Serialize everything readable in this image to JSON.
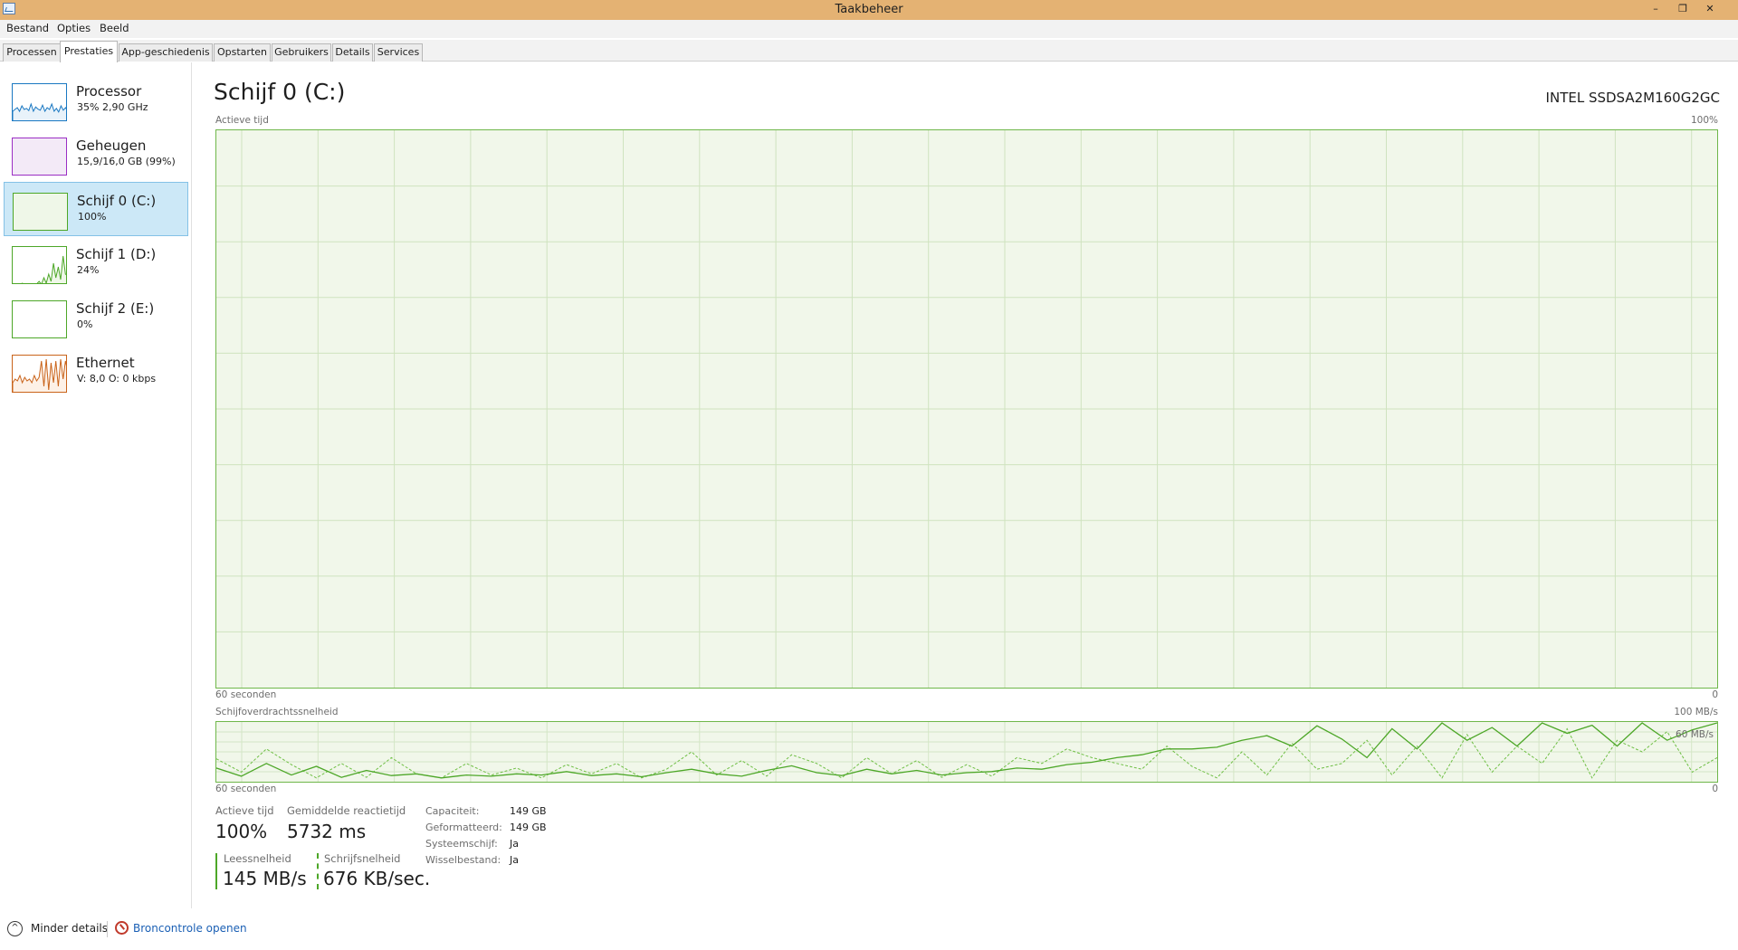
{
  "window": {
    "title": "Taakbeheer",
    "min_glyph": "–",
    "max_glyph": "❐",
    "close_glyph": "✕"
  },
  "menu": [
    "Bestand",
    "Opties",
    "Beeld"
  ],
  "tabs": [
    "Processen",
    "Prestaties",
    "App-geschiedenis",
    "Opstarten",
    "Gebruikers",
    "Details",
    "Services"
  ],
  "active_tab": "Prestaties",
  "sidebar": {
    "items": [
      {
        "title": "Processor",
        "sub": "35% 2,90 GHz",
        "color": "#1a78c2",
        "fill": "#e8f2fa",
        "level": 0.35
      },
      {
        "title": "Geheugen",
        "sub": "15,9/16,0 GB (99%)",
        "color": "#9b2ec4",
        "fill": "#f3eaf7",
        "level": 0.99
      },
      {
        "title": "Schijf 0 (C:)",
        "sub": "100%",
        "color": "#4da728",
        "fill": "#eff7e8",
        "level": 1.0,
        "selected": true
      },
      {
        "title": "Schijf 1 (D:)",
        "sub": "24%",
        "color": "#4da728",
        "fill": "#ffffff",
        "level": 0.24
      },
      {
        "title": "Schijf 2 (E:)",
        "sub": "0%",
        "color": "#4da728",
        "fill": "#ffffff",
        "level": 0.0
      },
      {
        "title": "Ethernet",
        "sub": "V: 8,0 O: 0 kbps",
        "color": "#c9631a",
        "fill": "#fdf1e7",
        "level": 0.6
      }
    ]
  },
  "disk": {
    "title": "Schijf 0 (C:)",
    "model": "INTEL SSDSA2M160G2GC",
    "active_time_graph": {
      "label": "Actieve tijd",
      "max_label": "100%",
      "left_label": "60 seconden",
      "right_label": "0",
      "value_percent": 100
    },
    "transfer_graph": {
      "label": "Schijfoverdrachtssnelheid",
      "max_label": "100 MB/s",
      "inner_max_label": "60 MB/s",
      "left_label": "60 seconden",
      "right_label": "0",
      "read_mbps": [
        22,
        8,
        30,
        10,
        25,
        6,
        18,
        9,
        12,
        5,
        10,
        8,
        12,
        10,
        16,
        9,
        12,
        7,
        14,
        20,
        12,
        8,
        18,
        26,
        14,
        9,
        20,
        12,
        18,
        10,
        14,
        16,
        22,
        20,
        28,
        32,
        40,
        45,
        55,
        55,
        58,
        70,
        78,
        60,
        95,
        72,
        40,
        90,
        55,
        100,
        70,
        92,
        60,
        100,
        82,
        96,
        60,
        100,
        70,
        88,
        100
      ],
      "write_mbps": [
        38,
        15,
        55,
        28,
        5,
        30,
        6,
        40,
        12,
        5,
        30,
        10,
        22,
        5,
        28,
        12,
        30,
        5,
        20,
        50,
        10,
        35,
        8,
        45,
        30,
        5,
        40,
        12,
        35,
        6,
        28,
        8,
        40,
        30,
        55,
        40,
        30,
        20,
        60,
        25,
        5,
        50,
        10,
        65,
        20,
        30,
        70,
        10,
        60,
        5,
        80,
        15,
        60,
        30,
        90,
        5,
        70,
        50,
        85,
        15,
        40
      ]
    },
    "stats": {
      "active_time_label": "Actieve tijd",
      "active_time": "100%",
      "latency_label": "Gemiddelde reactietijd",
      "latency": "5732 ms",
      "read_label": "Leessnelheid",
      "read": "145 MB/s",
      "write_label": "Schrijfsnelheid",
      "write": "676 KB/sec."
    },
    "properties": [
      {
        "label": "Capaciteit:",
        "value": "149 GB"
      },
      {
        "label": "Geformatteerd:",
        "value": "149 GB"
      },
      {
        "label": "Systeemschijf:",
        "value": "Ja"
      },
      {
        "label": "Wisselbestand:",
        "value": "Ja"
      }
    ]
  },
  "footer": {
    "less_details": "Minder details",
    "resource_monitor": "Broncontrole openen",
    "less_icon": "^"
  }
}
